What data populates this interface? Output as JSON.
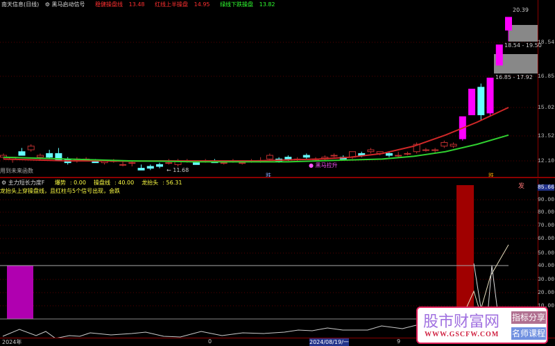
{
  "header": {
    "stock": "南天信息(日线)",
    "indicator": "黑马启动信号",
    "items": [
      {
        "label": "稳健操盘线",
        "value": "13.48",
        "color": "#ff3030"
      },
      {
        "label": "红线上半操盘",
        "value": "14.95",
        "color": "#ff3030"
      },
      {
        "label": "绿线下跌操盘",
        "value": "13.82",
        "color": "#30ff30"
      }
    ]
  },
  "main": {
    "price_axis": [
      "18.54",
      "16.85",
      "15.02",
      "13.52",
      "12.10"
    ],
    "annotations": {
      "high": "20.39",
      "zone1": "18.54 - 19.50",
      "zone2": "16.85 - 17.92",
      "low": "11.68",
      "note": "用到未来函数",
      "signal": "黑马拉升",
      "mark1": "跌",
      "mark2": "跌"
    },
    "candles": [
      [
        12.3,
        12.5,
        12.2,
        12.4
      ],
      [
        12.2,
        12.3,
        12.0,
        12.3
      ],
      [
        12.6,
        12.8,
        12.4,
        12.4
      ],
      [
        12.7,
        13.0,
        12.6,
        12.9
      ],
      [
        12.3,
        12.5,
        12.1,
        12.4
      ],
      [
        12.5,
        12.7,
        12.2,
        12.3
      ],
      [
        12.5,
        12.8,
        12.1,
        12.1
      ],
      [
        12.2,
        12.3,
        11.9,
        12.0
      ],
      [
        12.2,
        12.3,
        12.0,
        12.2
      ],
      [
        12.2,
        12.3,
        12.1,
        12.2
      ],
      [
        12.1,
        12.2,
        12.0,
        12.0
      ],
      [
        12.0,
        12.1,
        11.9,
        12.1
      ],
      [
        12.1,
        12.2,
        12.0,
        12.1
      ],
      [
        11.9,
        12.1,
        11.8,
        11.9
      ],
      [
        12.0,
        12.1,
        11.8,
        12.0
      ],
      [
        11.7,
        11.9,
        11.6,
        11.6
      ],
      [
        11.8,
        11.9,
        11.6,
        11.7
      ],
      [
        11.9,
        12.0,
        11.7,
        11.8
      ],
      [
        12.0,
        12.2,
        11.9,
        12.0
      ],
      [
        11.9,
        12.2,
        11.8,
        12.1
      ],
      [
        12.1,
        12.2,
        12.0,
        12.1
      ],
      [
        12.0,
        12.1,
        11.9,
        11.9
      ],
      [
        12.1,
        12.2,
        12.0,
        12.1
      ],
      [
        12.1,
        12.2,
        12.0,
        12.0
      ],
      [
        12.0,
        12.1,
        11.9,
        12.0
      ],
      [
        12.1,
        12.2,
        12.0,
        12.1
      ],
      [
        12.0,
        12.1,
        11.9,
        12.0
      ],
      [
        12.1,
        12.2,
        12.0,
        12.1
      ],
      [
        12.1,
        12.3,
        12.0,
        12.1
      ],
      [
        12.2,
        12.5,
        12.1,
        12.4
      ],
      [
        12.2,
        12.3,
        12.0,
        12.1
      ],
      [
        12.3,
        12.4,
        12.1,
        12.2
      ],
      [
        12.2,
        12.3,
        12.1,
        12.2
      ],
      [
        12.4,
        12.5,
        12.2,
        12.3
      ],
      [
        12.2,
        12.3,
        12.1,
        12.2
      ],
      [
        12.2,
        12.4,
        12.1,
        12.3
      ],
      [
        12.4,
        12.5,
        12.3,
        12.4
      ],
      [
        12.3,
        12.4,
        12.2,
        12.2
      ],
      [
        12.3,
        12.6,
        12.2,
        12.6
      ],
      [
        12.5,
        12.6,
        12.3,
        12.4
      ],
      [
        12.6,
        12.8,
        12.5,
        12.7
      ],
      [
        12.5,
        12.6,
        12.4,
        12.6
      ],
      [
        12.5,
        12.6,
        12.3,
        12.4
      ],
      [
        12.4,
        12.6,
        12.3,
        12.4
      ],
      [
        12.5,
        12.6,
        12.4,
        12.5
      ],
      [
        12.6,
        13.1,
        12.5,
        13.0
      ],
      [
        12.7,
        12.8,
        12.6,
        12.7
      ],
      [
        12.7,
        12.8,
        12.5,
        12.7
      ],
      [
        12.9,
        13.2,
        12.8,
        13.1
      ],
      [
        12.9,
        13.1,
        12.8,
        13.0
      ],
      [
        13.3,
        14.5,
        13.2,
        14.5
      ],
      [
        14.6,
        16.0,
        14.6,
        16.0
      ],
      [
        16.1,
        16.3,
        14.3,
        14.6
      ],
      [
        14.7,
        16.6,
        14.5,
        16.6
      ],
      [
        17.3,
        18.4,
        17.3,
        18.4
      ],
      [
        19.2,
        19.9,
        18.6,
        19.9
      ]
    ],
    "ma_red": [
      12.2,
      12.15,
      12.1,
      12.1,
      12.08,
      12.1,
      12.1,
      12.1,
      12.1,
      12.15,
      12.2,
      12.3,
      12.5,
      12.9,
      13.5,
      14.2,
      15.0
    ],
    "ma_green": [
      12.3,
      12.25,
      12.2,
      12.15,
      12.1,
      12.08,
      12.05,
      12.05,
      12.05,
      12.05,
      12.1,
      12.15,
      12.2,
      12.35,
      12.6,
      13.0,
      13.5
    ]
  },
  "sub": {
    "title": "主力短长力度F",
    "items": [
      {
        "label": "爆势",
        "value": "0.00"
      },
      {
        "label": "操盘线",
        "value": "40.00"
      },
      {
        "label": "龙抬头",
        "value": "56.31"
      }
    ],
    "desc": "龙抬头上穿操盘线，且红柱与5个信号出现，会跌",
    "axis": [
      "90.00",
      "80.00",
      "70.00",
      "60.00",
      "50.00",
      "40.00",
      "30.00",
      "20.00",
      "10.00"
    ],
    "current": "85.66",
    "bar_label": "发",
    "line_threshold": 40
  },
  "dates": {
    "start": "2024年",
    "mid": "0",
    "cursor": "2024/08/19/一",
    "end": "9"
  },
  "watermark": {
    "name": "股市财富网",
    "url": "WWW.GSCFW.COM",
    "tag1": "指标分享",
    "tag2": "名师课程"
  }
}
